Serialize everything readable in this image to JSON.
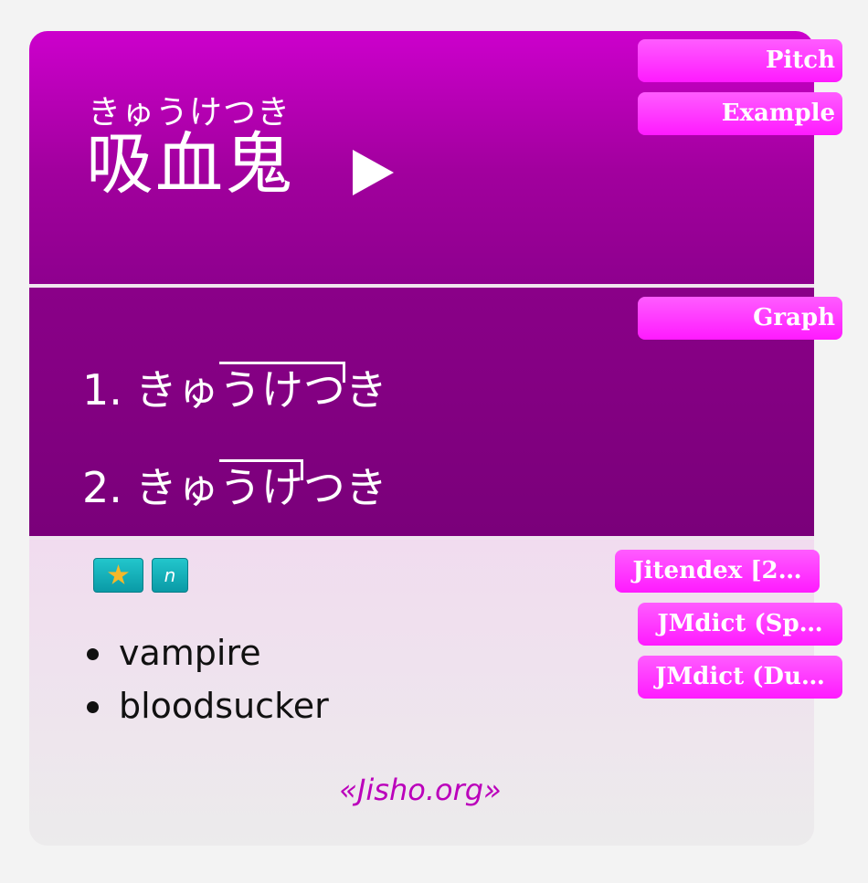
{
  "header": {
    "reading": "きゅうけつき",
    "kanji": "吸血鬼",
    "play_icon": "play-icon"
  },
  "pitch": {
    "entries": [
      {
        "num": "1.",
        "morae": [
          {
            "text": "きゅ",
            "high": false,
            "drop": false
          },
          {
            "text": "うけつ",
            "high": true,
            "drop": true
          },
          {
            "text": "き",
            "high": false,
            "drop": false
          }
        ]
      },
      {
        "num": "2.",
        "morae": [
          {
            "text": "きゅ",
            "high": false,
            "drop": false
          },
          {
            "text": "うけ",
            "high": true,
            "drop": true
          },
          {
            "text": "つき",
            "high": false,
            "drop": false
          }
        ]
      }
    ]
  },
  "definition": {
    "tags": [
      {
        "icon": "star-icon",
        "label": ""
      },
      {
        "icon": "",
        "label": "n"
      }
    ],
    "glosses": [
      "vampire",
      "bloodsucker"
    ],
    "source": "«Jisho.org»"
  },
  "side_tabs": {
    "pitch": "Pitch",
    "example": "Example",
    "graph": "Graph",
    "jitendex": "Jitendex [2…",
    "jmdict_sp": "JMdict (Sp…",
    "jmdict_du": "JMdict (Du…"
  },
  "colors": {
    "header_top": "#cc00cc",
    "pitch_bg": "#8a0088",
    "tab_pink": "#ff33ff",
    "tag_teal": "#14b0ba",
    "source_link": "#bb00bb"
  }
}
